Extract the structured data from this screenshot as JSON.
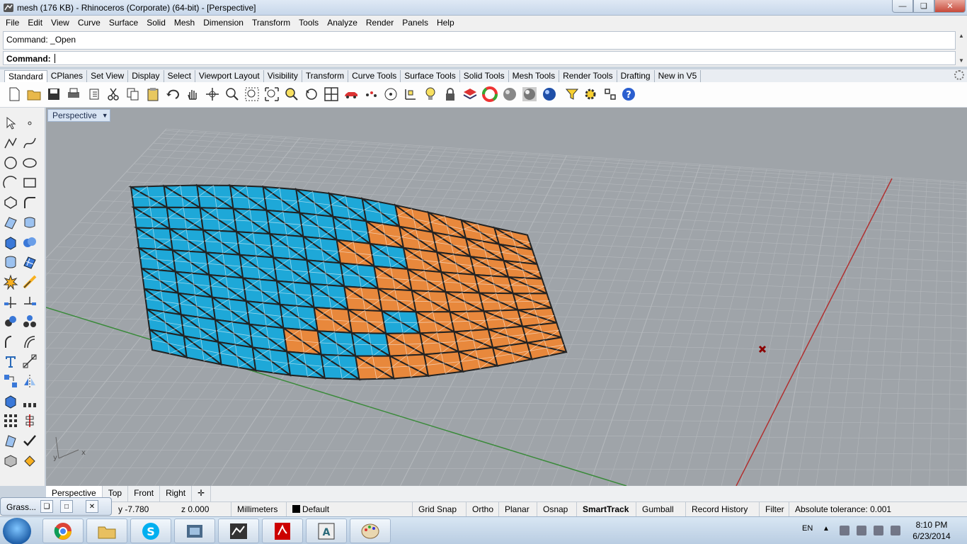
{
  "window": {
    "title": "mesh (176 KB) - Rhinoceros (Corporate) (64-bit) - [Perspective]"
  },
  "menu": [
    "File",
    "Edit",
    "View",
    "Curve",
    "Surface",
    "Solid",
    "Mesh",
    "Dimension",
    "Transform",
    "Tools",
    "Analyze",
    "Render",
    "Panels",
    "Help"
  ],
  "command": {
    "history": "Command: _Open",
    "prompt_label": "Command:",
    "value": ""
  },
  "toolbar_tabs": [
    "Standard",
    "CPlanes",
    "Set View",
    "Display",
    "Select",
    "Viewport Layout",
    "Visibility",
    "Transform",
    "Curve Tools",
    "Surface Tools",
    "Solid Tools",
    "Mesh Tools",
    "Render Tools",
    "Drafting",
    "New in V5"
  ],
  "viewport": {
    "label": "Perspective",
    "axis_x": "x",
    "axis_y": "y",
    "colors": {
      "background": "#9fa4a9",
      "grid": "#b4b8bc",
      "x_axis": "#b03030",
      "y_axis": "#3a8a3a",
      "panel_blue": "#1ea8d8",
      "panel_orange": "#e8883c"
    }
  },
  "viewport_tabs": [
    "Perspective",
    "Top",
    "Front",
    "Right"
  ],
  "status": {
    "y": "y -7.780",
    "z": "z 0.000",
    "units": "Millimeters",
    "layer": "Default",
    "buttons": [
      "Grid Snap",
      "Ortho",
      "Planar",
      "Osnap",
      "SmartTrack",
      "Gumball",
      "Record History",
      "Filter"
    ],
    "active_button": "SmartTrack",
    "tolerance": "Absolute tolerance: 0.001"
  },
  "grasshopper_window": {
    "title": "Grass..."
  },
  "taskbar": {
    "language": "EN",
    "time": "8:10 PM",
    "date": "6/23/2014",
    "apps": [
      "chrome-icon",
      "file-explorer-icon",
      "skype-icon",
      "media-icon",
      "rhino-icon",
      "acrobat-icon",
      "autocad-icon",
      "paint-icon"
    ]
  }
}
